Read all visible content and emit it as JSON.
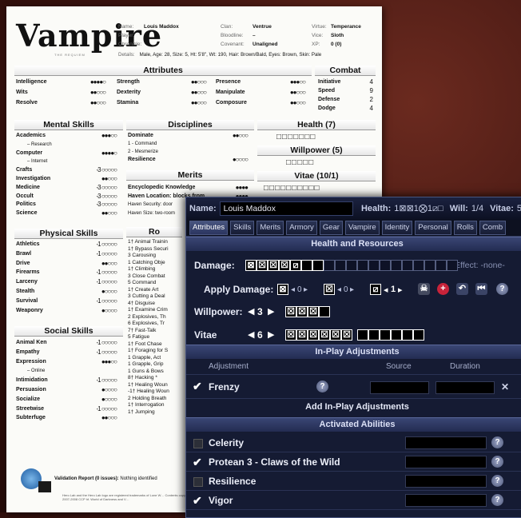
{
  "sheet": {
    "logo": "Vampire",
    "logo_sub": "THE REQUIEM",
    "header": {
      "name_k": "Name:",
      "name": "Louis Maddox",
      "player_k": "Player:",
      "chronicle_k": "Chronicle:",
      "clan_k": "Clan:",
      "clan": "Ventrue",
      "bloodline_k": "Bloodline:",
      "bloodline": "–",
      "covenant_k": "Covenant:",
      "covenant": "Unaligned",
      "virtue_k": "Virtue:",
      "virtue": "Temperance",
      "vice_k": "Vice:",
      "vice": "Sloth",
      "xp_k": "XP:",
      "xp": "0 (0)",
      "details_k": "Details:",
      "details": "Male, Age: 28, Size: 5, Ht: 5'8\", Wt: 190, Hair: Brown/Bald, Eyes: Brown, Skin: Pale"
    },
    "titles": {
      "attributes": "Attributes",
      "combat": "Combat",
      "mental": "Mental Skills",
      "disciplines": "Disciplines",
      "health": "Health (7)",
      "willpower": "Willpower (5)",
      "merits": "Merits",
      "vitae": "Vitae (10/1)",
      "physical": "Physical Skills",
      "social": "Social Skills",
      "ro": "Ro"
    },
    "attributes": [
      [
        "Intelligence",
        "●●●●○"
      ],
      [
        "Strength",
        "●●○○○"
      ],
      [
        "Presence",
        "●●●○○"
      ],
      [
        "Wits",
        "●●○○○"
      ],
      [
        "Dexterity",
        "●●○○○"
      ],
      [
        "Manipulate",
        "●●○○○"
      ],
      [
        "Resolve",
        "●●○○○"
      ],
      [
        "Stamina",
        "●●○○○"
      ],
      [
        "Composure",
        "●●○○○"
      ]
    ],
    "combat": [
      [
        "Initiative",
        "4"
      ],
      [
        "Speed",
        "9"
      ],
      [
        "Defense",
        "2"
      ],
      [
        "Dodge",
        "4"
      ]
    ],
    "mental": [
      [
        "Academics",
        "●●●○○"
      ],
      [
        "– Research",
        ""
      ],
      [
        "Computer",
        "●●●●○"
      ],
      [
        "– Internet",
        ""
      ],
      [
        "Crafts",
        "-3 ○○○○○"
      ],
      [
        "Investigation",
        "●●○○○"
      ],
      [
        "Medicine",
        "-3 ○○○○○"
      ],
      [
        "Occult",
        "-3 ○○○○○"
      ],
      [
        "Politics",
        "-3 ○○○○○"
      ],
      [
        "Science",
        "●●○○○"
      ]
    ],
    "disciplines": [
      [
        "Dominate",
        "●●○○○"
      ],
      [
        "1 - Command",
        ""
      ],
      [
        "2 - Mesmerize",
        ""
      ],
      [
        "Resilience",
        "●○○○○"
      ]
    ],
    "merits": [
      [
        "Encyclopedic Knowledge",
        "●●●●"
      ],
      [
        "Haven Location: blocks from",
        "●●●●"
      ],
      [
        "Haven Security: door",
        ""
      ],
      [
        "Haven Size: two-room",
        ""
      ]
    ],
    "health_boxes": "□□□□□□□",
    "willpower_boxes": "□□□□□",
    "vitae_boxes": "□□□□□□□□□□",
    "physical": [
      [
        "Athletics",
        "-1 ○○○○○"
      ],
      [
        "Brawl",
        "-1 ○○○○○"
      ],
      [
        "Drive",
        "●●○○○"
      ],
      [
        "Firearms",
        "-1 ○○○○○"
      ],
      [
        "Larceny",
        "-1 ○○○○○"
      ],
      [
        "Stealth",
        "●○○○○"
      ],
      [
        "Survival",
        "-1 ○○○○○"
      ],
      [
        "Weaponry",
        "●○○○○"
      ]
    ],
    "social": [
      [
        "Animal Ken",
        "-1 ○○○○○"
      ],
      [
        "Empathy",
        "-1 ○○○○○"
      ],
      [
        "Expression",
        "●●●○○"
      ],
      [
        "– Online",
        ""
      ],
      [
        "Intimidation",
        "-1 ○○○○○"
      ],
      [
        "Persuasion",
        "●○○○○"
      ],
      [
        "Socialize",
        "●○○○○"
      ],
      [
        "Streetwise",
        "-1 ○○○○○"
      ],
      [
        "Subterfuge",
        "●●○○○"
      ]
    ],
    "ro_list": [
      "1† Animal Trainin",
      "1† Bypass Securi",
      "3 Carousing",
      "1 Catching Obje",
      "1† Climbing",
      "3 Close Combat",
      "5 Command",
      "1† Create Art",
      "3 Cutting a Deal",
      "4† Disguise",
      "1† Examine Crim",
      "2 Explosives, Th",
      "6 Explosives, Tr",
      "7† Fast-Talk",
      "5 Fatigue",
      "1† Foot Chase",
      "1† Foraging for S",
      "1 Grapple, Act",
      "1 Grapple, Grip",
      "1 Guns & Bows",
      "8† Hacking *",
      "1† Healing Woun",
      "-1† Healing Woun",
      "2 Holding Breath",
      "1† Interrogation",
      "1† Jumping"
    ],
    "validation": "Validation Report (0 issues):",
    "validation_note": "Nothing identified",
    "footer_small": "Hero Lab and the Hero Lab logo are registered trademarks of Lone W… Contents copyright © 2007-2008 CCP hf. World of Darkness and V…"
  },
  "panel": {
    "top": {
      "name_label": "Name:",
      "name_value": "Louis Maddox",
      "health_label": "Health:",
      "health_value": "1⊠⊠1⨂1⧄□",
      "will_label": "Will:",
      "will_value": "1/4",
      "vitae_label": "Vitae:",
      "vitae_value": "5"
    },
    "tabs": [
      "Attributes",
      "Skills",
      "Merits",
      "Armory",
      "Gear",
      "Vampire",
      "Identity",
      "Personal",
      "Rolls",
      "Comb"
    ],
    "health_section": "Health and Resources",
    "damage_label": "Damage:",
    "effect_label": "Effect: -none-",
    "apply_label": "Apply Damage:",
    "apply_counts": [
      "0",
      "0",
      "1"
    ],
    "willpower_label": "Willpower:",
    "willpower_value": "3",
    "vitae_label": "Vitae",
    "vitae_value": "6",
    "inplay_section": "In-Play Adjustments",
    "col_adjustment": "Adjustment",
    "col_source": "Source",
    "col_duration": "Duration",
    "adj_name": "Frenzy",
    "add_inplay": "Add In-Play Adjustments",
    "abilities_section": "Activated Abilities",
    "abilities": [
      {
        "name": "Celerity",
        "checked": false
      },
      {
        "name": "Protean 3 - Claws of the Wild",
        "checked": true
      },
      {
        "name": "Resilience",
        "checked": false
      },
      {
        "name": "Vigor",
        "checked": true
      }
    ],
    "question_mark": "?",
    "close_x": "✕",
    "checkmark": "✔",
    "colors": {
      "panel_bg": "#12172a",
      "header": "#3a4674",
      "skull": "#ffffff",
      "heal": "#cc2233"
    }
  }
}
